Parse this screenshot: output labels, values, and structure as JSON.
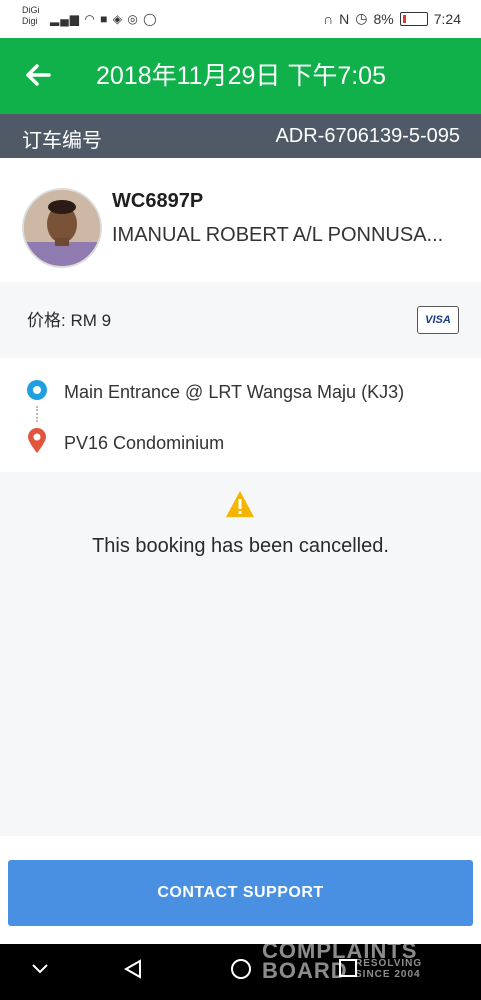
{
  "status_bar": {
    "carrier_line1": "DiGi",
    "carrier_line2": "Digi",
    "battery": "8%",
    "time": "7:24"
  },
  "header": {
    "title": "2018年11月29日 下午7:05"
  },
  "booking": {
    "label": "订车编号",
    "id": "ADR-6706139-5-095"
  },
  "driver": {
    "plate": "WC6897P",
    "name": "IMANUAL ROBERT A/L PONNUSA..."
  },
  "price": {
    "text": "价格: RM 9",
    "card": "VISA"
  },
  "route": {
    "pickup": "Main Entrance @ LRT Wangsa Maju (KJ3)",
    "dropoff": "PV16 Condominium"
  },
  "status": {
    "message": "This booking has been cancelled."
  },
  "actions": {
    "contact": "CONTACT SUPPORT"
  },
  "watermark": {
    "line1": "COMPLAINTS",
    "line2": "BOARD",
    "tag1": "RESOLVING",
    "tag2": "SINCE 2004"
  },
  "colors": {
    "header": "#10b04b",
    "idbar": "#4f5a66",
    "button": "#4a90e2",
    "pickup": "#1ea0e0",
    "dropoff": "#e2553d",
    "warning": "#f4b400"
  }
}
